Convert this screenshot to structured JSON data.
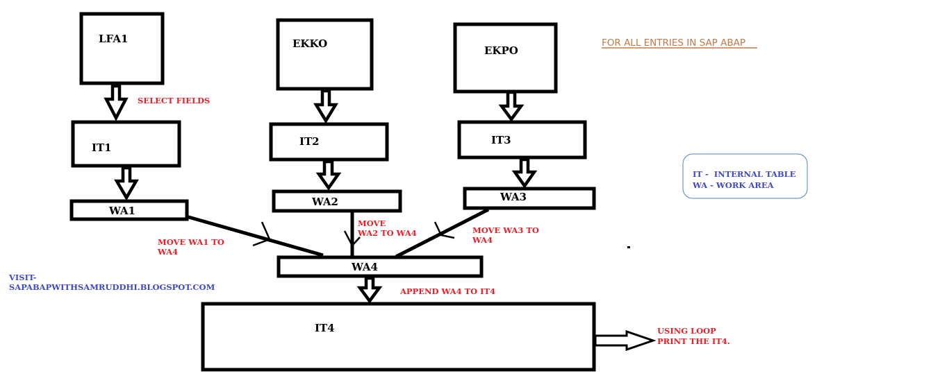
{
  "title": {
    "text": "FOR ALL ENTRIES IN SAP ABAP",
    "color": "#c07a4a"
  },
  "colors": {
    "stroke": "#000000",
    "annotation": "#ee1c24",
    "legend_text": "#3f48cc",
    "legend_border": "#4f81bd"
  },
  "tables": {
    "lfa1": "LFA1",
    "ekko": "EKKO",
    "ekpo": "EKPO"
  },
  "internal_tables": {
    "it1": "IT1",
    "it2": "IT2",
    "it3": "IT3",
    "it4": "IT4"
  },
  "work_areas": {
    "wa1": "WA1",
    "wa2": "WA2",
    "wa3": "WA3",
    "wa4": "WA4"
  },
  "annotations": {
    "select_fields": "SELECT FIELDS",
    "move_wa1": [
      "MOVE WA1 TO",
      "WA4"
    ],
    "move_wa2": [
      "MOVE",
      "WA2 TO WA4"
    ],
    "move_wa3": [
      "MOVE WA3 TO",
      "WA4"
    ],
    "append": "APPEND WA4 TO IT4",
    "loop": [
      "USING LOOP",
      "PRINT THE IT4."
    ]
  },
  "legend": {
    "line1": "IT -  INTERNAL TABLE",
    "line2": "WA - WORK AREA"
  },
  "visit": {
    "line1": "VISIT-",
    "line2": "SAPABAPWITHSAMRUDDHI.BLOGSPOT.COM"
  }
}
